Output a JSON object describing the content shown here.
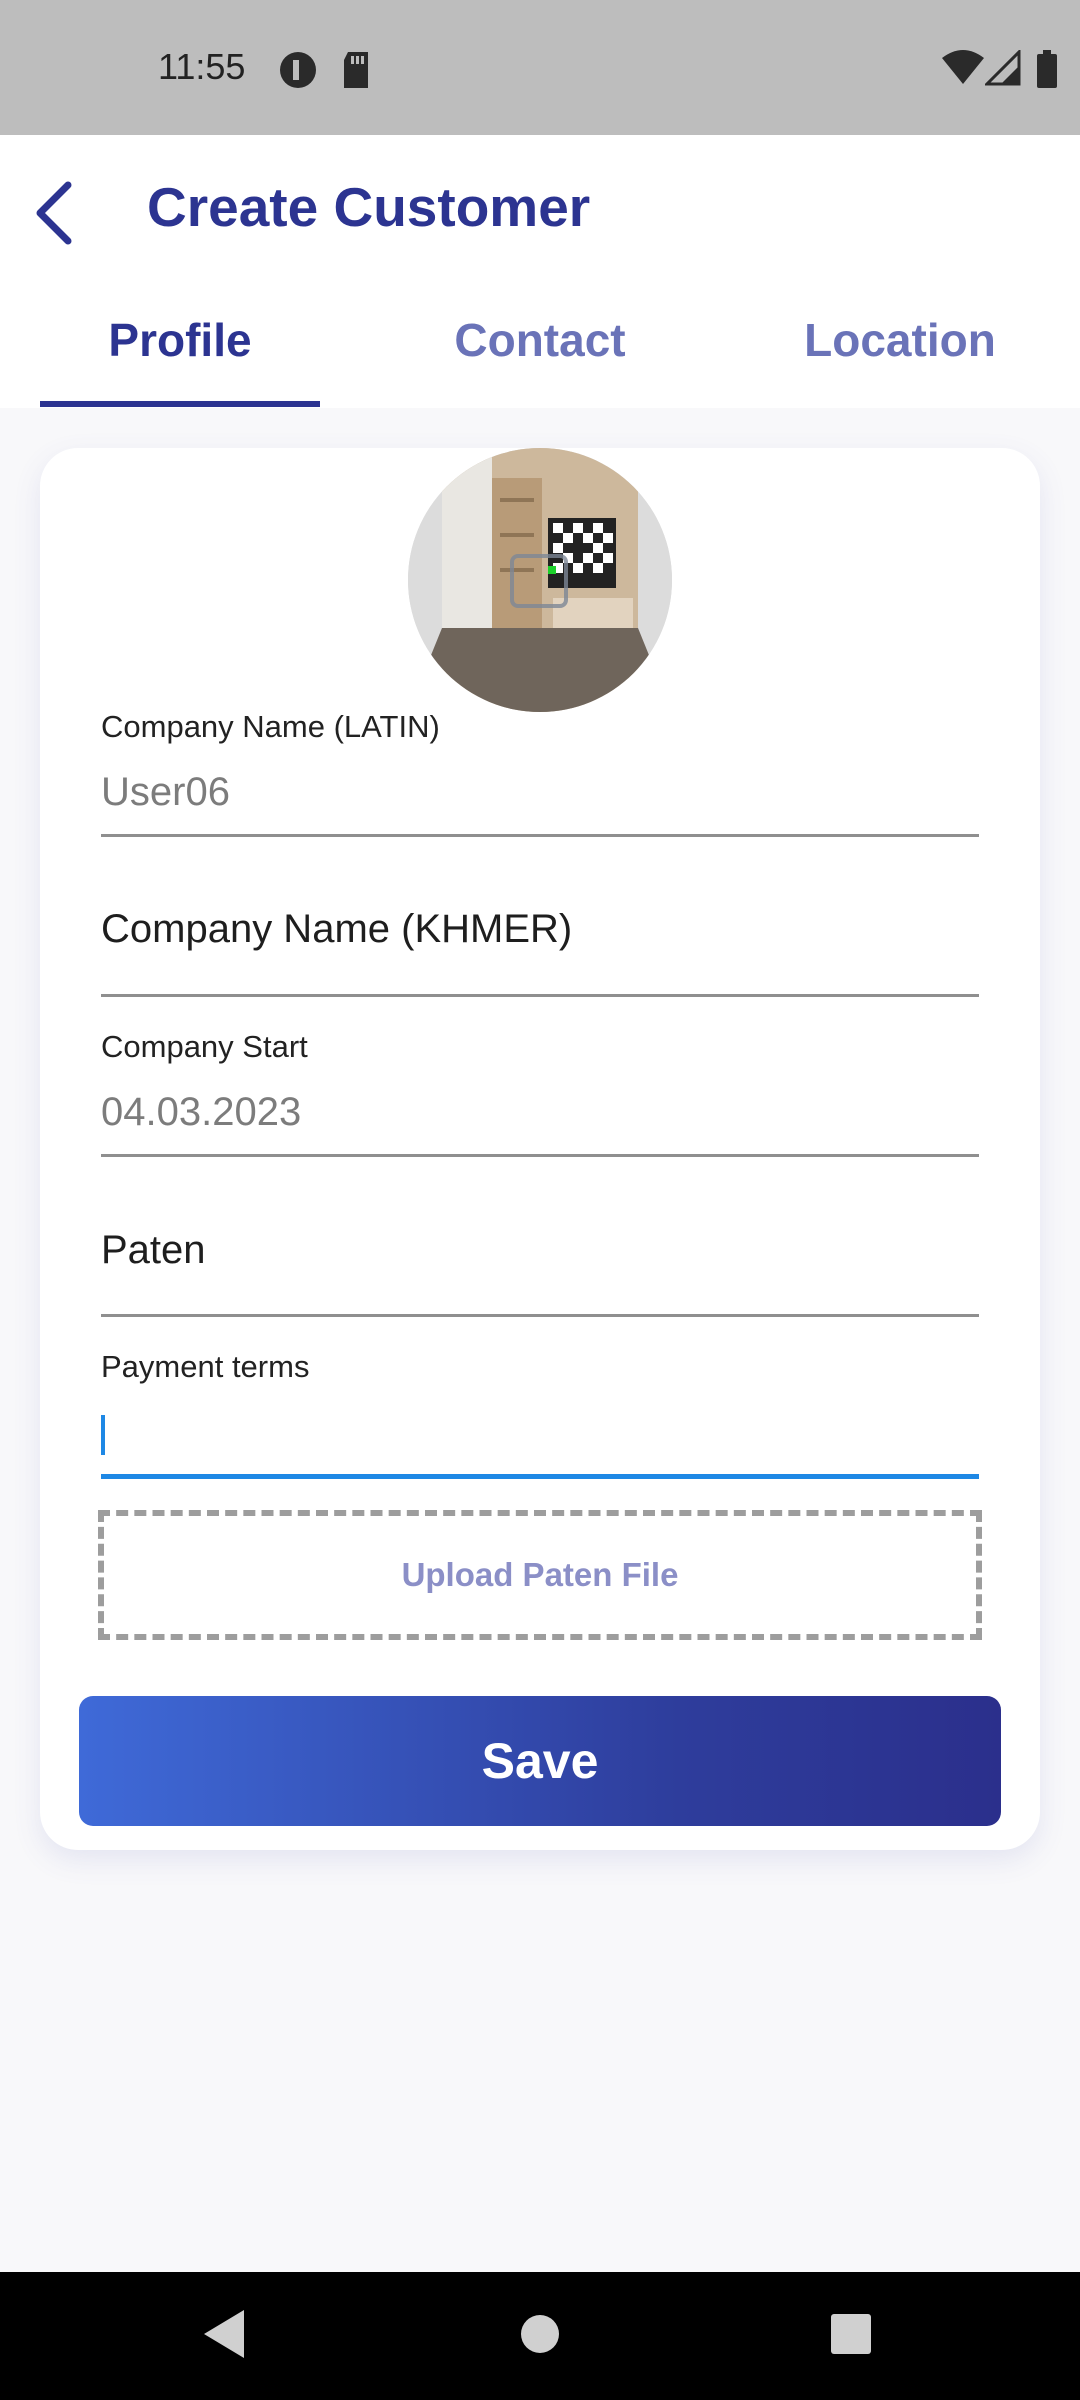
{
  "status_bar": {
    "time": "11:55",
    "icons": [
      "dnd-icon",
      "sd-card-icon",
      "wifi-icon",
      "signal-icon",
      "battery-icon"
    ]
  },
  "header": {
    "title": "Create Customer",
    "back_icon": "back-arrow-icon"
  },
  "tabs": [
    {
      "label": "Profile",
      "active": true
    },
    {
      "label": "Contact",
      "active": false
    },
    {
      "label": "Location",
      "active": false
    }
  ],
  "form": {
    "company_name_latin": {
      "label": "Company Name (LATIN)",
      "value": "User06"
    },
    "company_name_khmer": {
      "placeholder": "Company Name (KHMER)"
    },
    "company_start": {
      "label": "Company Start",
      "value": "04.03.2023"
    },
    "paten": {
      "placeholder": "Paten"
    },
    "payment_terms": {
      "label": "Payment terms",
      "value": ""
    },
    "upload_label": "Upload Paten File",
    "save_label": "Save"
  },
  "colors": {
    "primary": "#2c3491",
    "tab_inactive": "#6a73b8",
    "accent_blue": "#1e88e5",
    "button_gradient_start": "#3f6ad8",
    "button_gradient_end": "#2b2f8c"
  },
  "nav_bar": {
    "icons": [
      "nav-back-icon",
      "nav-home-icon",
      "nav-recents-icon"
    ]
  }
}
